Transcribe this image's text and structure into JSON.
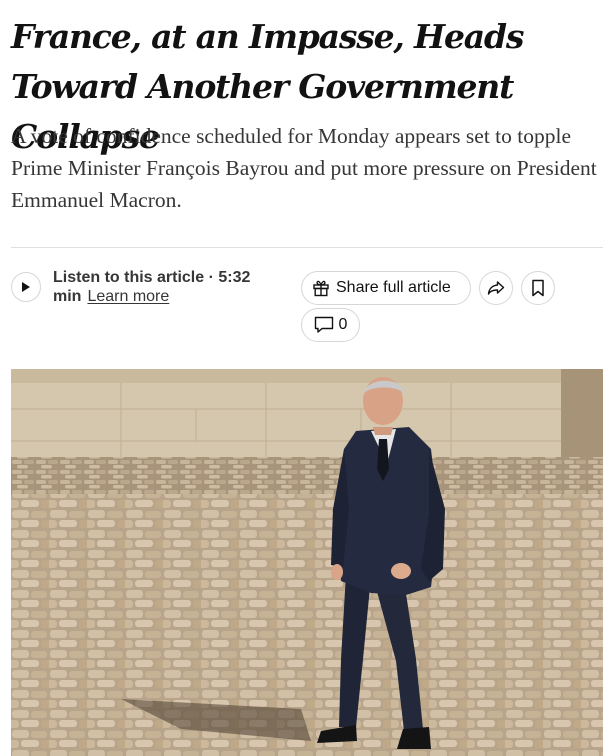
{
  "article": {
    "headline": "France, at an Impasse, Heads Toward Another Government Collapse",
    "summary": "A vote of confidence scheduled for Monday appears set to topple Prime Minister François Bayrou and put more pressure on President Emmanuel Macron."
  },
  "audio": {
    "listen_label": "Listen to this article · 5:32 min",
    "learn_more": "Learn more"
  },
  "actions": {
    "share_full_label": "Share full article",
    "comments_count": "0"
  },
  "icons": {
    "play": "play-icon",
    "gift": "gift-icon",
    "share": "share-arrow-icon",
    "bookmark": "bookmark-icon",
    "comment": "comment-bubble-icon"
  },
  "colors": {
    "text": "#121212",
    "summary_text": "#363636",
    "border": "#d6d6d6",
    "divider": "#dfdfdf"
  }
}
